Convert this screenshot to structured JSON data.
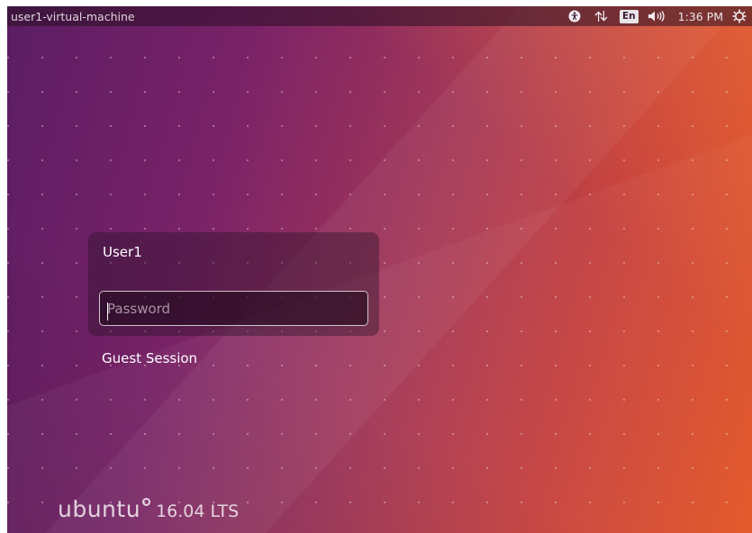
{
  "panel": {
    "hostname": "user1-virtual-machine",
    "keyboard_layout": "En",
    "clock": "1:36 PM",
    "icons": [
      "accessibility-icon",
      "network-icon",
      "keyboard-layout-indicator",
      "sound-icon",
      "power-icon"
    ]
  },
  "login": {
    "user_name": "User1",
    "password_placeholder": "Password",
    "password_value": ""
  },
  "guest_session": "Guest Session",
  "branding": {
    "word": "ubuntu",
    "version": "16.04 LTS"
  },
  "colors": {
    "bg_left": "#5b1d63",
    "bg_right": "#e35423",
    "accent": "#dd4814"
  }
}
